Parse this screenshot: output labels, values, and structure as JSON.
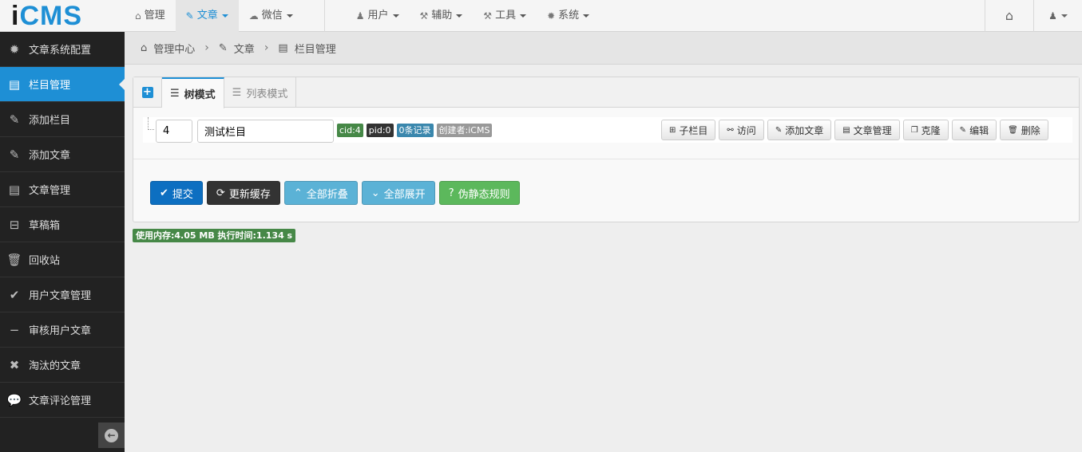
{
  "brand": {
    "logo_i": "i",
    "logo_cms": "CMS"
  },
  "nav": {
    "items": [
      {
        "label": "管理",
        "icon": "home-icon",
        "glyph": "⌂"
      },
      {
        "label": "文章",
        "icon": "edit-icon",
        "glyph": "✎"
      },
      {
        "label": "微信",
        "icon": "wechat-icon",
        "glyph": "☁"
      },
      {
        "label": "用户",
        "icon": "user-icon",
        "glyph": "♟"
      },
      {
        "label": "辅助",
        "icon": "gavel-icon",
        "glyph": "⚒"
      },
      {
        "label": "工具",
        "icon": "wrench-icon",
        "glyph": "⚒"
      },
      {
        "label": "系统",
        "icon": "cog-icon",
        "glyph": "✹"
      }
    ],
    "right_home_glyph": "⌂",
    "right_user_glyph": "♟"
  },
  "sidebar": {
    "items": [
      {
        "label": "文章系统配置",
        "icon": "cog-icon",
        "glyph": "✹"
      },
      {
        "label": "栏目管理",
        "icon": "list-alt-icon",
        "glyph": "▤"
      },
      {
        "label": "添加栏目",
        "icon": "edit-icon",
        "glyph": "✎"
      },
      {
        "label": "添加文章",
        "icon": "edit-icon",
        "glyph": "✎"
      },
      {
        "label": "文章管理",
        "icon": "list-alt-icon",
        "glyph": "▤"
      },
      {
        "label": "草稿箱",
        "icon": "inbox-icon",
        "glyph": "⊟"
      },
      {
        "label": "回收站",
        "icon": "trash-icon",
        "glyph": "🗑"
      },
      {
        "label": "用户文章管理",
        "icon": "check-circle-icon",
        "glyph": "✔"
      },
      {
        "label": "审核用户文章",
        "icon": "minus-circle-icon",
        "glyph": "−"
      },
      {
        "label": "淘汰的文章",
        "icon": "times-circle-icon",
        "glyph": "✖"
      },
      {
        "label": "文章评论管理",
        "icon": "comments-icon",
        "glyph": "💬"
      }
    ],
    "active_index": 1,
    "collapse_glyph": "←"
  },
  "breadcrumb": {
    "items": [
      {
        "label": "管理中心",
        "glyph": "⌂"
      },
      {
        "label": "文章",
        "glyph": "✎"
      },
      {
        "label": "栏目管理",
        "glyph": "▤"
      }
    ],
    "separator": "›"
  },
  "tabs": {
    "add_glyph": "+",
    "items": [
      {
        "label": "树模式",
        "glyph": "☰"
      },
      {
        "label": "列表模式",
        "glyph": "☰"
      }
    ],
    "active_index": 0
  },
  "tree": {
    "order_value": "4",
    "name_value": "测试栏目",
    "badges": {
      "cid": "cid:4",
      "pid": "pid:0",
      "records": "0条记录",
      "creator": "创建者:iCMS"
    },
    "actions": [
      {
        "label": "子栏目",
        "glyph": "⊞"
      },
      {
        "label": "访问",
        "glyph": "⚯"
      },
      {
        "label": "添加文章",
        "glyph": "✎"
      },
      {
        "label": "文章管理",
        "glyph": "▤"
      },
      {
        "label": "克隆",
        "glyph": "❐"
      },
      {
        "label": "编辑",
        "glyph": "✎"
      },
      {
        "label": "删除",
        "glyph": "🗑"
      }
    ]
  },
  "form_actions": [
    {
      "label": "提交",
      "glyph": "✔"
    },
    {
      "label": "更新缓存",
      "glyph": "⟳"
    },
    {
      "label": "全部折叠",
      "glyph": "⌃"
    },
    {
      "label": "全部展开",
      "glyph": "⌄"
    },
    {
      "label": "伪静态规则",
      "glyph": "?"
    }
  ],
  "status": "使用内存:4.05 MB 执行时间:1.134 s",
  "colors": {
    "accent": "#1e8fd5",
    "sidebar_bg": "#222222",
    "success": "#468847"
  }
}
